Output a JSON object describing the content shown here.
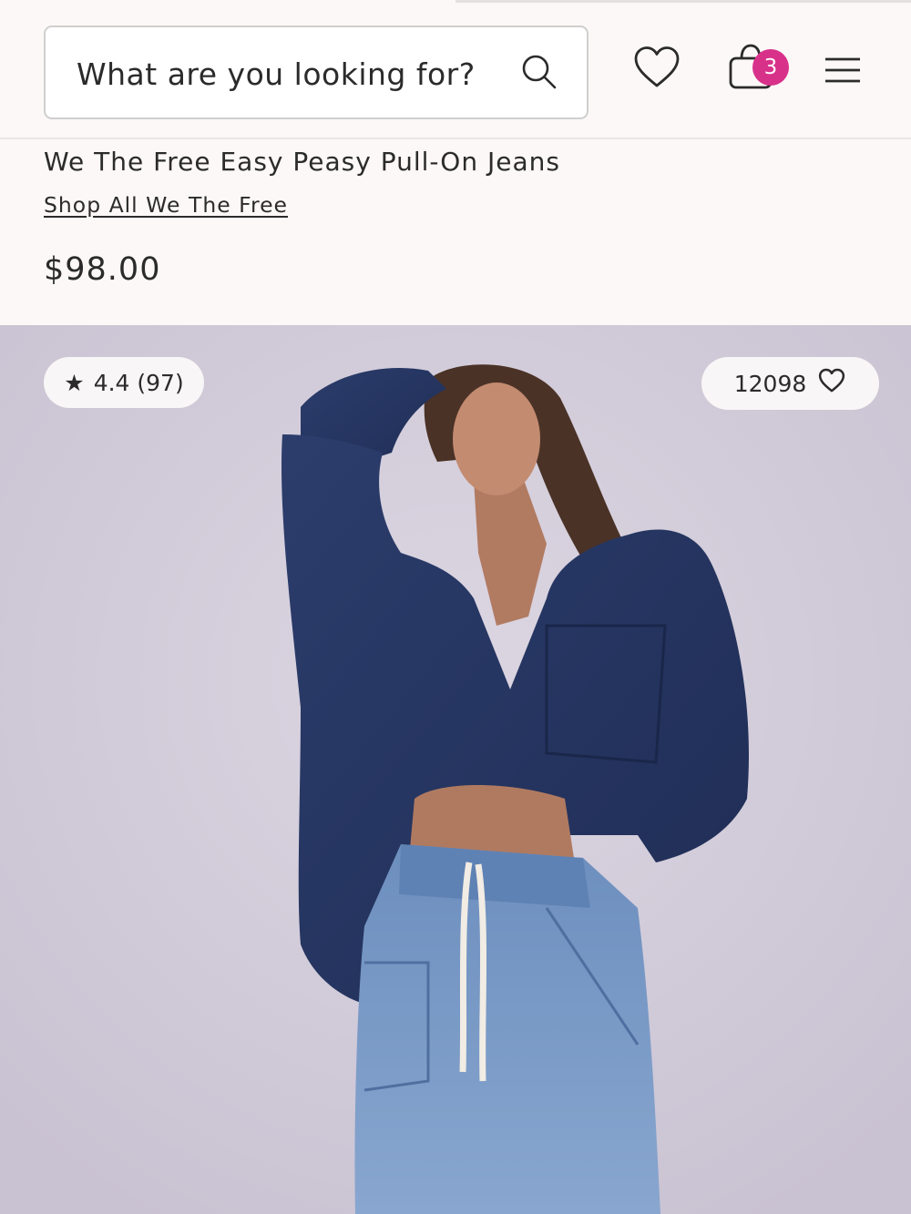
{
  "header": {
    "search_placeholder": "What are you looking for?",
    "bag_count": "3"
  },
  "product": {
    "title": "We The Free Easy Peasy Pull-On Jeans",
    "brand_link": "Shop All We The Free",
    "price": "$98.00"
  },
  "gallery": {
    "rating": "4.4 (97)",
    "favorites_count": "12098"
  },
  "icons": {
    "search": "search-icon",
    "wishlist": "heart-icon",
    "bag": "shopping-bag-icon",
    "menu": "hamburger-menu-icon",
    "rating": "star-icon"
  },
  "colors": {
    "accent": "#d8318a",
    "background": "#fcf8f7",
    "photo_background": "#d1cbd9"
  }
}
